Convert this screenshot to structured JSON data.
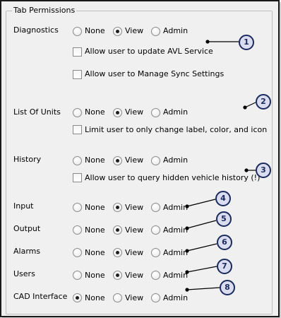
{
  "panel": {
    "title": "Tab Permissions"
  },
  "options": {
    "none": "None",
    "view": "View",
    "admin": "Admin"
  },
  "rows": [
    {
      "label": "Diagnostics",
      "selected": "view"
    },
    {
      "label": "List Of Units",
      "selected": "view"
    },
    {
      "label": "History",
      "selected": "view"
    },
    {
      "label": "Input",
      "selected": "view"
    },
    {
      "label": "Output",
      "selected": "view"
    },
    {
      "label": "Alarms",
      "selected": "view"
    },
    {
      "label": "Users",
      "selected": "view"
    },
    {
      "label": "CAD Interface",
      "selected": "none"
    }
  ],
  "checkboxes": [
    {
      "label": "Allow user to update AVL Service",
      "checked": false
    },
    {
      "label": "Allow user to Manage Sync Settings",
      "checked": false
    },
    {
      "label": "Limit user to only change label, color, and icon",
      "checked": false
    },
    {
      "label": "Allow user to query hidden vehicle history (!)",
      "checked": false
    }
  ],
  "callouts": [
    "1",
    "2",
    "3",
    "4",
    "5",
    "6",
    "7",
    "8"
  ],
  "colors": {
    "badge_fill": "#d9ddef",
    "badge_border": "#1b2a5c",
    "leader_line": "#000000",
    "panel_bg": "#f0f0f0"
  }
}
